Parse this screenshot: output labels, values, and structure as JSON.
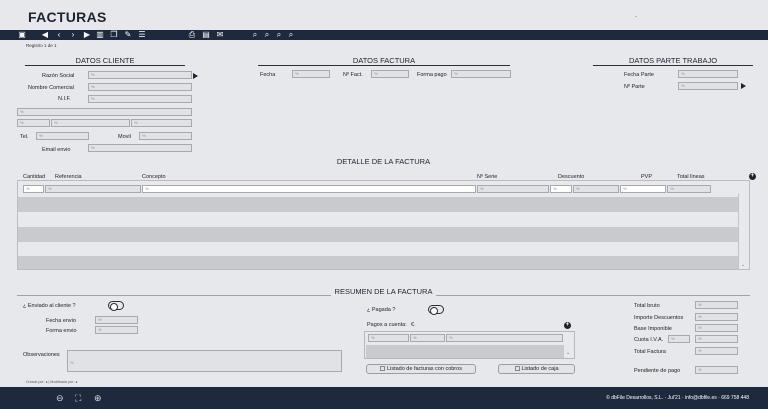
{
  "app": {
    "title": "FACTURAS",
    "dot": "."
  },
  "toolbar": {
    "icons": [
      "window-icon",
      "first-record-icon",
      "prev-record-icon",
      "next-record-icon",
      "last-record-icon",
      "trash-icon",
      "copy-icon",
      "edit-icon",
      "list-icon",
      "print-icon",
      "document-icon",
      "email-icon",
      "search-icon",
      "search-icon",
      "search-icon",
      "search-icon"
    ]
  },
  "registro": "Registro 1 de 1",
  "datos_cliente": {
    "title": "DATOS CLIENTE",
    "razon_social_label": "Razón Social",
    "nombre_comercial_label": "Nombre Comercial",
    "nif_label": "N.I.F.",
    "tel_label": "Tel.",
    "movil_label": "Movil",
    "email_label": "Email envio",
    "placeholder": "%"
  },
  "datos_factura": {
    "title": "DATOS FACTURA",
    "fecha_label": "Fecha",
    "nfact_label": "Nº Fact.",
    "forma_pago_label": "Forma pago"
  },
  "datos_parte": {
    "title": "DATOS PARTE TRABAJO",
    "fecha_parte_label": "Fecha Parte",
    "n_parte_label": "Nº Parte"
  },
  "detalle": {
    "title": "DETALLE DE LA FACTURA",
    "columns": [
      "Cantidad",
      "Referencia",
      "Concepto",
      "Nº Serie",
      "Descuento",
      "PVP",
      "Total lineas"
    ]
  },
  "resumen": {
    "title": "RESUMEN DE LA FACTURA",
    "enviado_label": "¿ Enviado al cliente ?",
    "fecha_envio_label": "Fecha envio",
    "forma_envio_label": "Forma envio",
    "observaciones_label": "Observaciones",
    "pagada_label": "¿ Pagada ?",
    "pagos_label": "Pagos a cuenta:",
    "pagos_currency": "€.",
    "btn_listado_facturas": "Listado de facturas con cobros",
    "btn_listado_caja": "Listado de caja",
    "total_bruto_label": "Total bruto",
    "importe_desc_label": "Importe Descuentos",
    "base_imponible_label": "Base Imponible",
    "cuota_iva_label": "Cuota I.V.A.",
    "total_factura_label": "Total Factura",
    "pendiente_label": "Pendiente de pago"
  },
  "created": "Creado por: ●  |  Modificado por: ●",
  "footer": {
    "text": "© dbFile Desarrollos, S.L. · Jul'21 · info@dbfile.es · 669 758 448"
  }
}
